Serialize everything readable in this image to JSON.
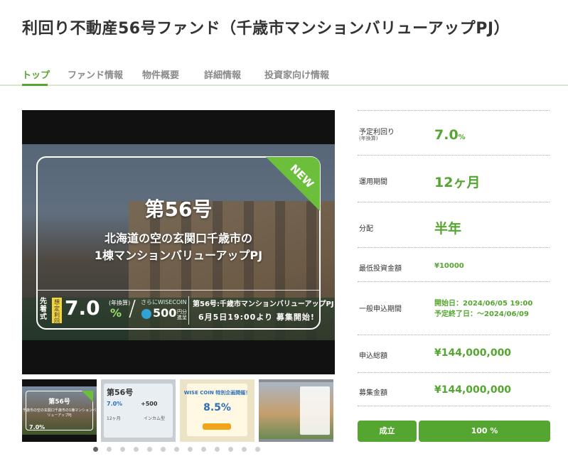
{
  "page": {
    "title": "利回り不動産56号ファンド（千歳市マンションバリューアップPJ）"
  },
  "tabs": [
    {
      "label": "トップ",
      "active": true
    },
    {
      "label": "ファンド情報",
      "active": false
    },
    {
      "label": "物件概要",
      "active": false
    },
    {
      "label": "詳細情報",
      "active": false
    },
    {
      "label": "投資家向け情報",
      "active": false
    }
  ],
  "hero": {
    "badge": "NEW",
    "issue": "第56号",
    "line1": "北海道の空の玄関口千歳市の",
    "line2": "1棟マンションバリューアップPJ",
    "first_come": "先着式",
    "tag": "想定利回",
    "rate": "7.0",
    "rate_unit": "%",
    "annual": "(年換算)",
    "coin_label": "さらにWISECOIN",
    "coin_value": "500",
    "coin_unit": "円分進呈",
    "fund_name": "第56号:千歳市マンションバリューアップPJ",
    "start": "6月5日19:00より 募集開始!"
  },
  "thumbnails": [
    {
      "title": "第56号",
      "subtitle": "千歳市の空の玄関口千歳市の1棟マンションバリューアップPJ",
      "rate": "7.0%"
    },
    {
      "title": "第56号",
      "rate": "7.0%",
      "coin": "+500",
      "term": "12ヶ月",
      "type": "インカム型"
    },
    {
      "title": "WISE COIN 特別企画開催！",
      "rate": "8.5%"
    },
    {
      "title": ""
    }
  ],
  "carousel": {
    "dot_count": 13,
    "active_index": 0
  },
  "info": {
    "expected_yield": {
      "label": "予定利回り",
      "sub": "(年換算)",
      "value": "7.0",
      "unit": "%"
    },
    "period": {
      "label": "運用期間",
      "value": "12ヶ月"
    },
    "distribution": {
      "label": "分配",
      "value": "半年"
    },
    "min_investment": {
      "label": "最低投資金額",
      "value": "¥10000"
    },
    "application_period": {
      "label": "一般申込期間",
      "start": "開始日：2024/06/05 19:00",
      "end": "予定終了日：～2024/06/09"
    },
    "total_applications": {
      "label": "申込総額",
      "value": "¥144,000,000"
    },
    "target_amount": {
      "label": "募集金額",
      "value": "¥144,000,000"
    }
  },
  "status": {
    "label": "成立",
    "progress": "100 %"
  },
  "colors": {
    "accent": "#55a630",
    "tab_inactive": "#8a8a8a",
    "new_ribbon": "#6cbf3a"
  }
}
